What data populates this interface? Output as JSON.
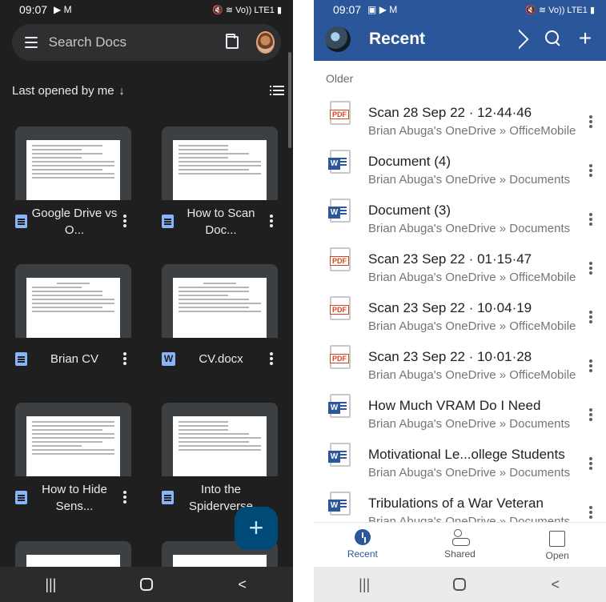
{
  "left_app": {
    "status": {
      "time": "09:07",
      "icons": "▶ M",
      "right": "🔇 ≋ Vo)) LTE1 ▮"
    },
    "search": {
      "placeholder": "Search Docs"
    },
    "sort": {
      "label": "Last opened by me",
      "arrow": "↓"
    },
    "documents": [
      {
        "title": "Google Drive vs O...",
        "type": "doc"
      },
      {
        "title": "How to Scan Doc...",
        "type": "doc"
      },
      {
        "title": "Brian CV",
        "type": "doc"
      },
      {
        "title": "CV.docx",
        "type": "word"
      },
      {
        "title": "How to Hide Sens...",
        "type": "doc"
      },
      {
        "title": "Into the Spiderverse",
        "type": "doc"
      }
    ],
    "fab_label": "+",
    "navbar": {
      "recents": "|||",
      "back": "<"
    }
  },
  "right_app": {
    "status": {
      "time": "09:07",
      "icons": "▣ ▶ M",
      "right": "🔇 ≋ Vo)) LTE1 ▮"
    },
    "header": {
      "title": "Recent",
      "plus": "+"
    },
    "section": "Older",
    "files": [
      {
        "title": "Scan 28 Sep 22 · 12·44·46",
        "location": "Brian Abuga's OneDrive » OfficeMobile",
        "type": "pdf"
      },
      {
        "title": "Document (4)",
        "location": "Brian Abuga's OneDrive » Documents",
        "type": "word"
      },
      {
        "title": "Document (3)",
        "location": "Brian Abuga's OneDrive » Documents",
        "type": "word"
      },
      {
        "title": "Scan 23 Sep 22 · 01·15·47",
        "location": "Brian Abuga's OneDrive » OfficeMobile",
        "type": "pdf"
      },
      {
        "title": "Scan 23 Sep 22 · 10·04·19",
        "location": "Brian Abuga's OneDrive » OfficeMobile",
        "type": "pdf"
      },
      {
        "title": "Scan 23 Sep 22 · 10·01·28",
        "location": "Brian Abuga's OneDrive » OfficeMobile",
        "type": "pdf"
      },
      {
        "title": "How Much VRAM Do I Need",
        "location": "Brian Abuga's OneDrive » Documents",
        "type": "word"
      },
      {
        "title": "Motivational Le...ollege Students",
        "location": "Brian Abuga's OneDrive » Documents",
        "type": "word"
      },
      {
        "title": "Tribulations of a War Veteran",
        "location": "Brian Abuga's OneDrive » Documents",
        "type": "word"
      }
    ],
    "file_icon_labels": {
      "pdf": "PDF",
      "word": "W"
    },
    "tabs": [
      {
        "label": "Recent"
      },
      {
        "label": "Shared"
      },
      {
        "label": "Open"
      }
    ],
    "navbar": {
      "recents": "|||",
      "back": "<"
    }
  }
}
